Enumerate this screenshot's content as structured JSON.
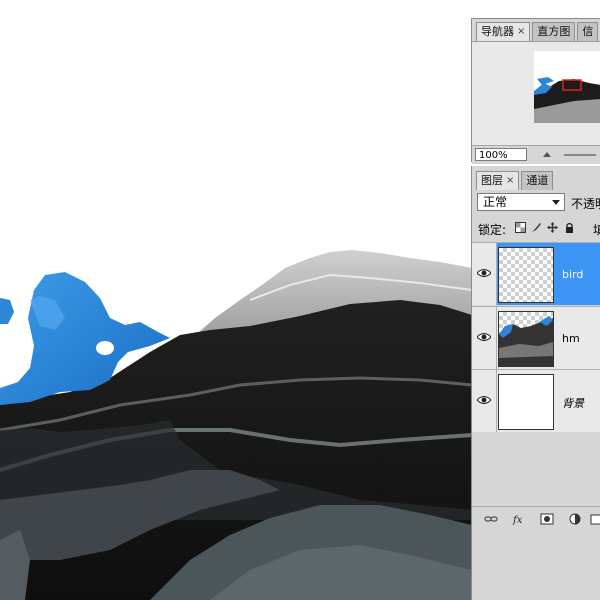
{
  "navigator": {
    "tabs": [
      {
        "label": "导航器",
        "has_close": true
      },
      {
        "label": "直方图",
        "has_close": false
      },
      {
        "label": "信",
        "has_close": false
      }
    ],
    "close_glyph": "×",
    "zoom_value": "100%"
  },
  "layers": {
    "tabs": [
      {
        "label": "图层",
        "has_close": true
      },
      {
        "label": "通道",
        "has_close": false
      }
    ],
    "blend_mode": "正常",
    "opacity_label": "不透明",
    "lock_label": "锁定:",
    "fill_label": "填",
    "items": [
      {
        "name": "bird",
        "selected": true,
        "visible": true
      },
      {
        "name": "hm",
        "selected": false,
        "visible": true
      },
      {
        "name": "背景",
        "selected": false,
        "visible": true
      }
    ]
  },
  "colors": {
    "panel_bg": "#d6d6d6",
    "selection_blue": "#3d95f6",
    "ink_blue": "#2c86d6",
    "ink_dark": "#141414"
  }
}
